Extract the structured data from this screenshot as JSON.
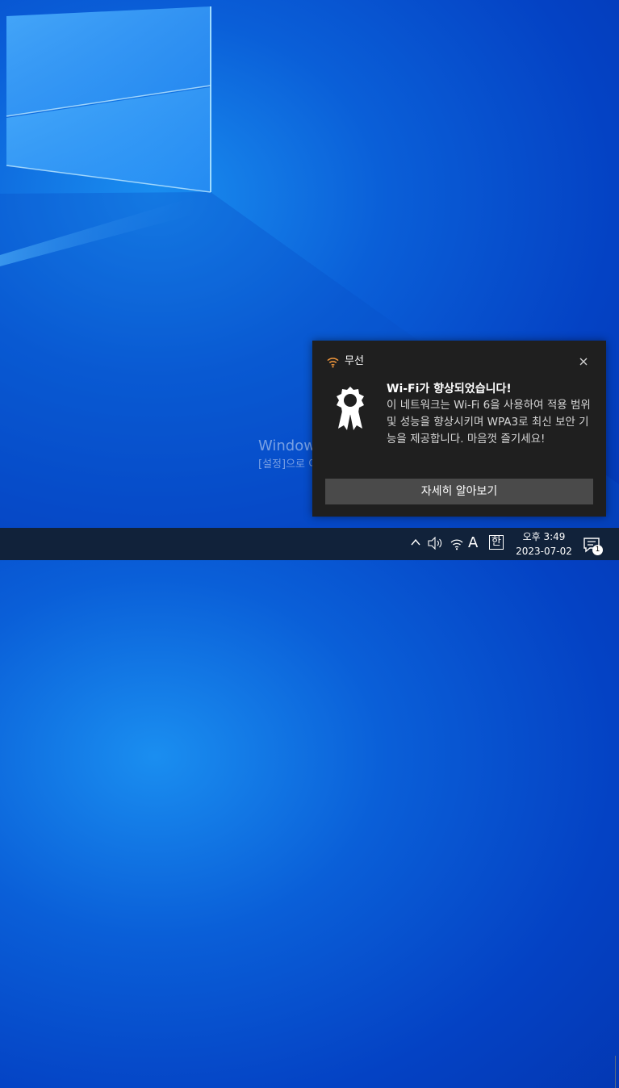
{
  "watermark": {
    "title": "Windows 정품 인증",
    "subtitle": "[설정]으로 이동하여 Windows를 정품 인증합니다."
  },
  "toast": {
    "app_name": "무선",
    "app_icon": "wifi-icon",
    "title": "Wi-Fi가 향상되었습니다!",
    "body": "이 네트워크는 Wi-Fi 6을 사용하여 적용 범위 및 성능을 향상시키며 WPA3로 최신 보안 기능을 제공합니다. 마음껏 즐기세요!",
    "button_label": "자세히 알아보기",
    "accent_color": "#f0963c"
  },
  "taskbar": {
    "language": "A",
    "ime": "한",
    "time": "오후 3:49",
    "date": "2023-07-02",
    "notification_count": "1"
  }
}
